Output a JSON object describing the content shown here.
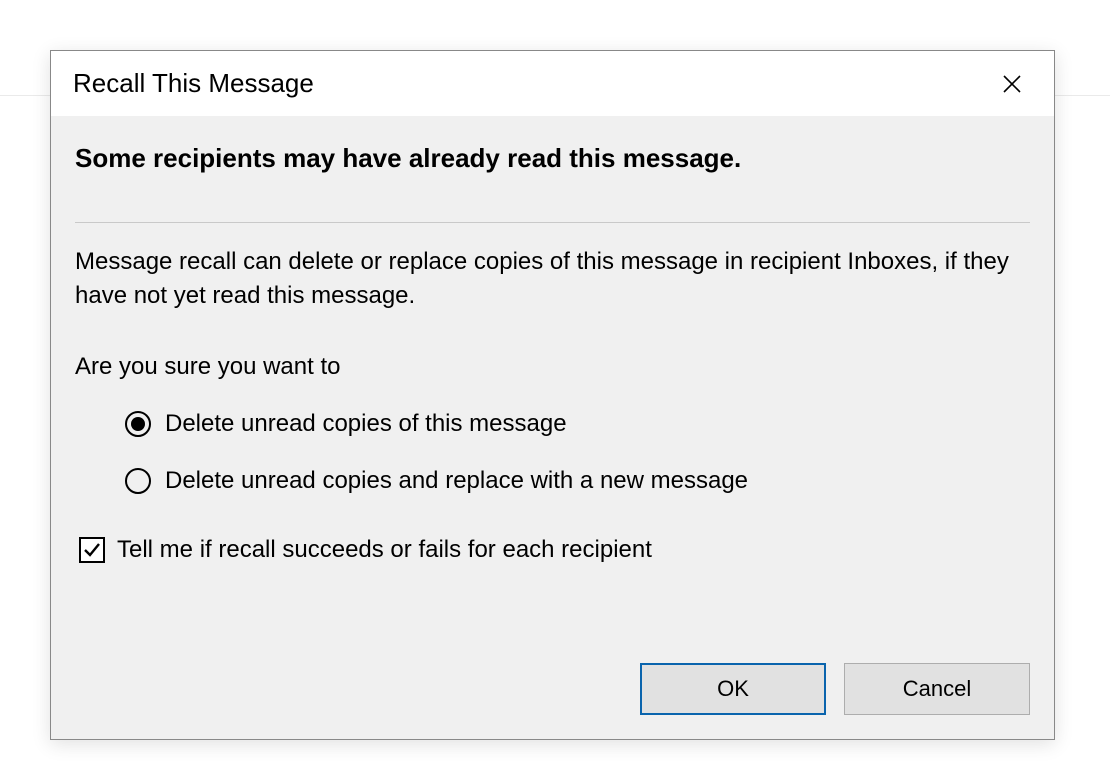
{
  "dialog": {
    "title": "Recall This Message",
    "headline": "Some recipients may have already read this message.",
    "body": "Message recall can delete or replace copies of this message in recipient Inboxes, if they have not yet read this message.",
    "prompt": "Are you sure you want to",
    "options": {
      "selected": 0,
      "items": [
        "Delete unread copies of this message",
        "Delete unread copies and replace with a new message"
      ]
    },
    "checkbox": {
      "checked": true,
      "label": "Tell me if recall succeeds or fails for each recipient"
    },
    "buttons": {
      "ok": "OK",
      "cancel": "Cancel"
    }
  }
}
